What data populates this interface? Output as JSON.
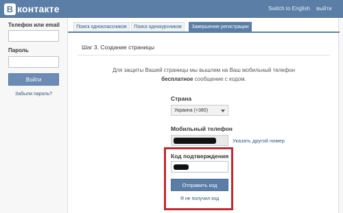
{
  "header": {
    "logo_letter": "B",
    "logo_text": "контакте",
    "switch_lang": "Switch to English",
    "exit": "выйти"
  },
  "sidebar": {
    "login_label": "Телефон или email",
    "password_label": "Пароль",
    "login_button": "Войти",
    "forgot_link": "Забыли пароль?"
  },
  "tabs": [
    {
      "label": "Поиск одноклассников",
      "active": false
    },
    {
      "label": "Поиск однокурсников",
      "active": false
    },
    {
      "label": "Завершение регистрации",
      "active": true
    }
  ],
  "step": {
    "title": "Шаг 3. Создание страницы",
    "info_line1": "Для защиты Вашей страницы мы вышлем на Ваш мобильный телефон",
    "info_bold": "бесплатное",
    "info_line2": "сообщение с кодом."
  },
  "form": {
    "country_label": "Страна",
    "country_value": "Украина (+380)",
    "phone_label": "Мобильный телефон",
    "other_number_link": "Указать другой номер",
    "code_label": "Код подтверждения",
    "send_button": "Отправить код",
    "no_code_link": "Я не получил код"
  },
  "colors": {
    "brand": "#5b7ea6",
    "highlight": "#c0282e"
  }
}
